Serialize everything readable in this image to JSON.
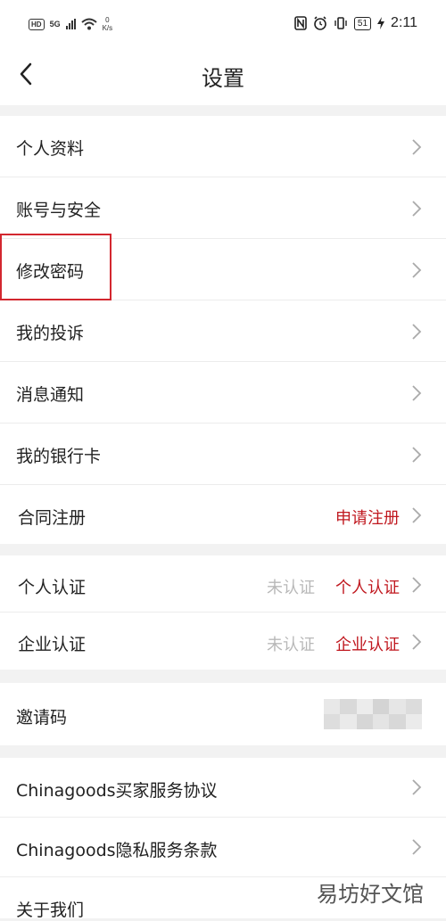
{
  "status_bar": {
    "hd": "HD",
    "network_type": "5G",
    "net_speed_value": "0",
    "net_speed_unit": "K/s",
    "battery": "51",
    "time": "2:11"
  },
  "header": {
    "title": "设置"
  },
  "settings": {
    "profile": "个人资料",
    "account_security": "账号与安全",
    "change_password": "修改密码",
    "complaints": "我的投诉",
    "notifications": "消息通知",
    "bank_cards": "我的银行卡",
    "contract_registration": "合同注册",
    "apply_registration": "申请注册"
  },
  "verification": {
    "personal_label": "个人认证",
    "personal_status": "未认证",
    "personal_action": "个人认证",
    "enterprise_label": "企业认证",
    "enterprise_status": "未认证",
    "enterprise_action": "企业认证"
  },
  "invite": {
    "label": "邀请码"
  },
  "about": {
    "buyer_agreement": "Chinagoods买家服务协议",
    "privacy_terms": "Chinagoods隐私服务条款",
    "about_us": "关于我们"
  },
  "watermark": "易坊好文馆"
}
